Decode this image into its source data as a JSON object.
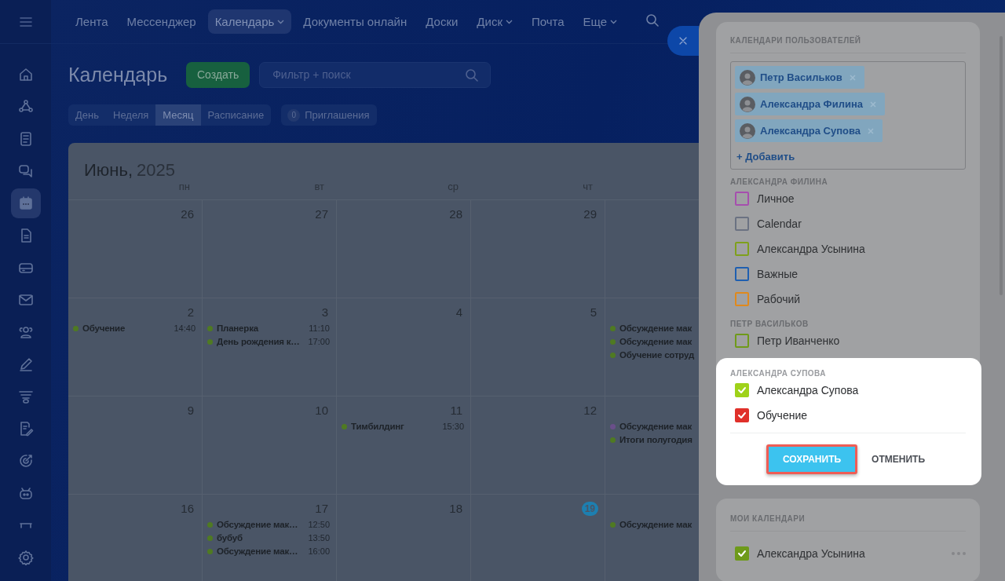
{
  "sidebar": {
    "items": [
      {
        "kind": "home",
        "selected": false
      },
      {
        "kind": "share",
        "selected": false
      },
      {
        "kind": "list",
        "selected": false
      },
      {
        "kind": "chat",
        "selected": false
      },
      {
        "kind": "calendar",
        "selected": true
      },
      {
        "kind": "document",
        "selected": false
      },
      {
        "kind": "inbox",
        "selected": false
      },
      {
        "kind": "mail",
        "selected": false
      },
      {
        "kind": "people",
        "selected": false
      },
      {
        "kind": "pen",
        "selected": false
      },
      {
        "kind": "funnel",
        "selected": false
      },
      {
        "kind": "checklist",
        "selected": false
      },
      {
        "kind": "target",
        "selected": false
      },
      {
        "kind": "robot",
        "selected": false
      },
      {
        "kind": "bench",
        "selected": false
      },
      {
        "kind": "settings",
        "selected": false
      }
    ]
  },
  "nav": {
    "items": [
      {
        "label": "Лента",
        "selected": false,
        "caret": false
      },
      {
        "label": "Мессенджер",
        "selected": false,
        "caret": false
      },
      {
        "label": "Календарь",
        "selected": true,
        "caret": true
      },
      {
        "label": "Документы онлайн",
        "selected": false,
        "caret": false
      },
      {
        "label": "Доски",
        "selected": false,
        "caret": false
      },
      {
        "label": "Диск",
        "selected": false,
        "caret": true
      },
      {
        "label": "Почта",
        "selected": false,
        "caret": false
      },
      {
        "label": "Еще",
        "selected": false,
        "caret": true
      }
    ]
  },
  "page": {
    "title": "Календарь",
    "create_button": "Создать",
    "search": {
      "placeholder": "Фильтр + поиск"
    },
    "view_tabs": [
      {
        "label": "День",
        "selected": false
      },
      {
        "label": "Неделя",
        "selected": false
      },
      {
        "label": "Месяц",
        "selected": true
      },
      {
        "label": "Расписание",
        "selected": false
      }
    ],
    "invitations": {
      "count": "0",
      "label": "Приглашения"
    }
  },
  "calendar": {
    "month": "Июнь,",
    "year": "2025",
    "weekdays": [
      "пн",
      "вт",
      "ср",
      "чт"
    ],
    "weeks": [
      {
        "days": [
          {
            "number": "26",
            "today": false
          },
          {
            "number": "27",
            "today": false
          },
          {
            "number": "28",
            "today": false
          },
          {
            "number": "29",
            "today": false
          }
        ]
      },
      {
        "days": [
          {
            "number": "2",
            "today": false,
            "events": [
              {
                "title": "Обучение",
                "time": "14:40",
                "color": "#4f7a22"
              }
            ]
          },
          {
            "number": "3",
            "today": false,
            "events": [
              {
                "title": "Планерка",
                "time": "11:10",
                "color": "#4f7a22"
              },
              {
                "title": "День рождения к…",
                "time": "17:00",
                "color": "#4f7a22"
              }
            ]
          },
          {
            "number": "4",
            "today": false
          },
          {
            "number": "5",
            "today": false
          },
          {
            "events": [
              {
                "title": "Обсуждение мак",
                "color": "#4f7a22"
              },
              {
                "title": "Обсуждение мак",
                "color": "#4f7a22"
              },
              {
                "title": "Обучение сотруд",
                "color": "#4f7a22"
              }
            ]
          }
        ]
      },
      {
        "days": [
          {
            "number": "9",
            "today": false
          },
          {
            "number": "10",
            "today": false
          },
          {
            "number": "11",
            "today": false,
            "events": [
              {
                "title": "Тимбилдинг",
                "time": "15:30",
                "color": "#4f7a22"
              }
            ]
          },
          {
            "number": "12",
            "today": false
          },
          {
            "events": [
              {
                "title": "Обсуждение мак",
                "color": "#6a4f8a"
              },
              {
                "title": "Итоги полугодия",
                "color": "#4f7a22"
              }
            ]
          }
        ]
      },
      {
        "days": [
          {
            "number": "16",
            "today": false
          },
          {
            "number": "17",
            "today": false,
            "events": [
              {
                "title": "Обсуждение мак…",
                "time": "12:50",
                "color": "#4f7a22"
              },
              {
                "title": "бубуб",
                "time": "13:50",
                "color": "#4f7a22"
              },
              {
                "title": "Обсуждение мак…",
                "time": "16:00",
                "color": "#4f7a22"
              }
            ]
          },
          {
            "number": "18",
            "today": false
          },
          {
            "number": "19",
            "today": true
          },
          {
            "events": [
              {
                "title": "Обсуждение мак",
                "color": "#4f7a22"
              }
            ]
          }
        ]
      }
    ]
  },
  "panel": {
    "section_title": "КАЛЕНДАРИ ПОЛЬЗОВАТЕЛЕЙ",
    "users": [
      {
        "name": "Петр Васильков"
      },
      {
        "name": "Александра Филина"
      },
      {
        "name": "Александра Супова"
      }
    ],
    "add_link": "+ Добавить",
    "groups": [
      {
        "title": "АЛЕКСАНДРА ФИЛИНА",
        "highlighted": false,
        "calendars": [
          {
            "name": "Личное",
            "color": "#a64fae",
            "checked": false
          },
          {
            "name": "Calendar",
            "color": "#6b7282",
            "checked": false
          },
          {
            "name": "Александра Усынина",
            "color": "#7fa01c",
            "checked": false
          },
          {
            "name": "Важные",
            "color": "#1f5fb0",
            "checked": false
          },
          {
            "name": "Рабочий",
            "color": "#e0891c",
            "checked": false
          }
        ]
      },
      {
        "title": "ПЕТР ВАСИЛЬКОВ",
        "highlighted": false,
        "calendars": [
          {
            "name": "Петр Иванченко",
            "color": "#6f9a1a",
            "checked": false
          }
        ]
      },
      {
        "title": "АЛЕКСАНДРА СУПОВА",
        "highlighted": true,
        "calendars": [
          {
            "name": "Александра Супова",
            "color": "#9fd21a",
            "checked": true
          },
          {
            "name": "Обучение",
            "color": "#e0302a",
            "checked": true
          }
        ]
      }
    ],
    "save_button": "СОХРАНИТЬ",
    "cancel_button": "ОТМЕНИТЬ",
    "my_calendars": {
      "title": "МОИ КАЛЕНДАРИ",
      "calendars": [
        {
          "name": "Александра Усынина",
          "color": "#6e9a1a",
          "checked": true
        }
      ]
    }
  }
}
